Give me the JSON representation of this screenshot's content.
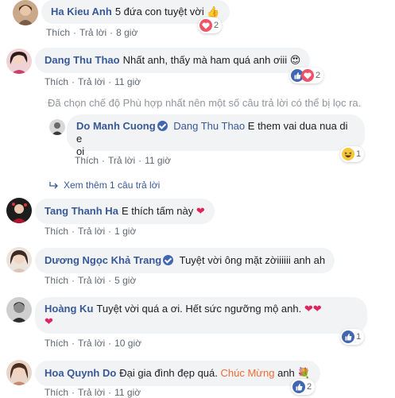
{
  "actions": {
    "like": "Thích",
    "reply": "Trả lời",
    "dot": "·"
  },
  "filter_note": "Đã chọn chế độ Phù hợp nhất nên một số câu trả lời có thể bị lọc ra.",
  "see_more": "Xem thêm 1 câu trả lời",
  "colors": {
    "name": "#385898",
    "bubble": "#f2f3f5",
    "meta": "#606770",
    "like_blue": "#4267b2",
    "love_red": "#f25268"
  },
  "comments": [
    {
      "name": "Ha Kieu Anh",
      "text": "5 đứa con tuyệt vời",
      "emoji": "👍",
      "time": "8 giờ",
      "reactions": [
        "heart"
      ],
      "reaction_count": "2"
    },
    {
      "name": "Dang Thu Thao",
      "text": "Nhất anh, thấy mà ham quá anh ơiii",
      "emoji": "😍",
      "time": "11 giờ",
      "reactions": [
        "like",
        "heart"
      ],
      "reaction_count": "2"
    },
    {
      "name": "Do Manh Cuong",
      "verified": true,
      "mention": "Dang Thu Thao",
      "text_line1": "E them vai dua nua di e",
      "text_line2": "oi",
      "time": "11 giờ",
      "reactions": [
        "haha"
      ],
      "reaction_count": "1"
    },
    {
      "name": "Tang Thanh Ha",
      "text": "E thích tấm này",
      "emoji": "❤",
      "time": "1 giờ"
    },
    {
      "name": "Dương Ngọc Khả Trang",
      "verified": true,
      "text": "Tuyệt vời ông mặt zờiiiiii anh ah",
      "time": "5 giờ"
    },
    {
      "name": "Hoàng Ku",
      "text": "Tuyệt vời quá a ơi. Hết sức ngưỡng mộ anh.",
      "emoji": "❤❤",
      "emoji_line2": "❤",
      "time": "10 giờ",
      "reactions": [
        "like"
      ],
      "reaction_count": "1"
    },
    {
      "name": "Hoa Quynh Do",
      "text": "Đại gia đình đẹp quá.",
      "highlight": "Chúc Mừng",
      "text_after": "anh",
      "emoji": "💐",
      "time": "11 giờ",
      "reactions": [
        "like"
      ],
      "reaction_count": "2"
    }
  ]
}
